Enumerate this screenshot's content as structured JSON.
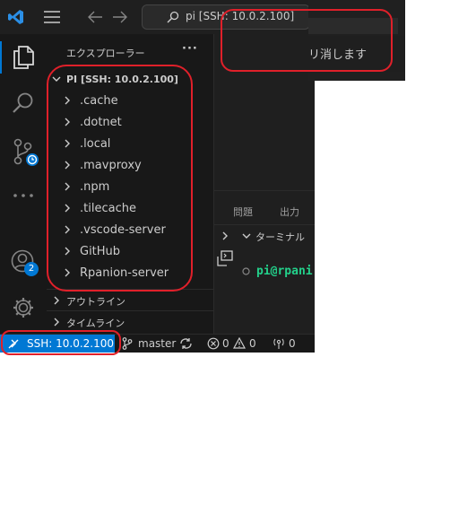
{
  "window": {
    "search_text": "pi [SSH: 10.0.2.100]",
    "notification_text": "リ消します"
  },
  "sidebar": {
    "title": "エクスプローラー",
    "more": "···",
    "root_folder": "PI [SSH: 10.0.2.100]",
    "items": [
      {
        "label": ".cache"
      },
      {
        "label": ".dotnet"
      },
      {
        "label": ".local"
      },
      {
        "label": ".mavproxy"
      },
      {
        "label": ".npm"
      },
      {
        "label": ".tilecache"
      },
      {
        "label": ".vscode-server"
      },
      {
        "label": "GitHub"
      },
      {
        "label": "Rpanion-server"
      }
    ],
    "outline": "アウトライン",
    "timeline": "タイムライン"
  },
  "activity_bar": {
    "accounts_badge": "2"
  },
  "panel": {
    "tabs": [
      "問題",
      "出力"
    ],
    "terminal_label": "ターミナル",
    "prompt": "pi@rpani"
  },
  "statusbar": {
    "remote": "SSH: 10.0.2.100",
    "branch": "master",
    "errors": "0",
    "warnings": "0",
    "ports": "0"
  },
  "colors": {
    "accent_blue": "#0078d4",
    "annotation_red": "#e0202a",
    "prompt_green": "#23d18b"
  }
}
